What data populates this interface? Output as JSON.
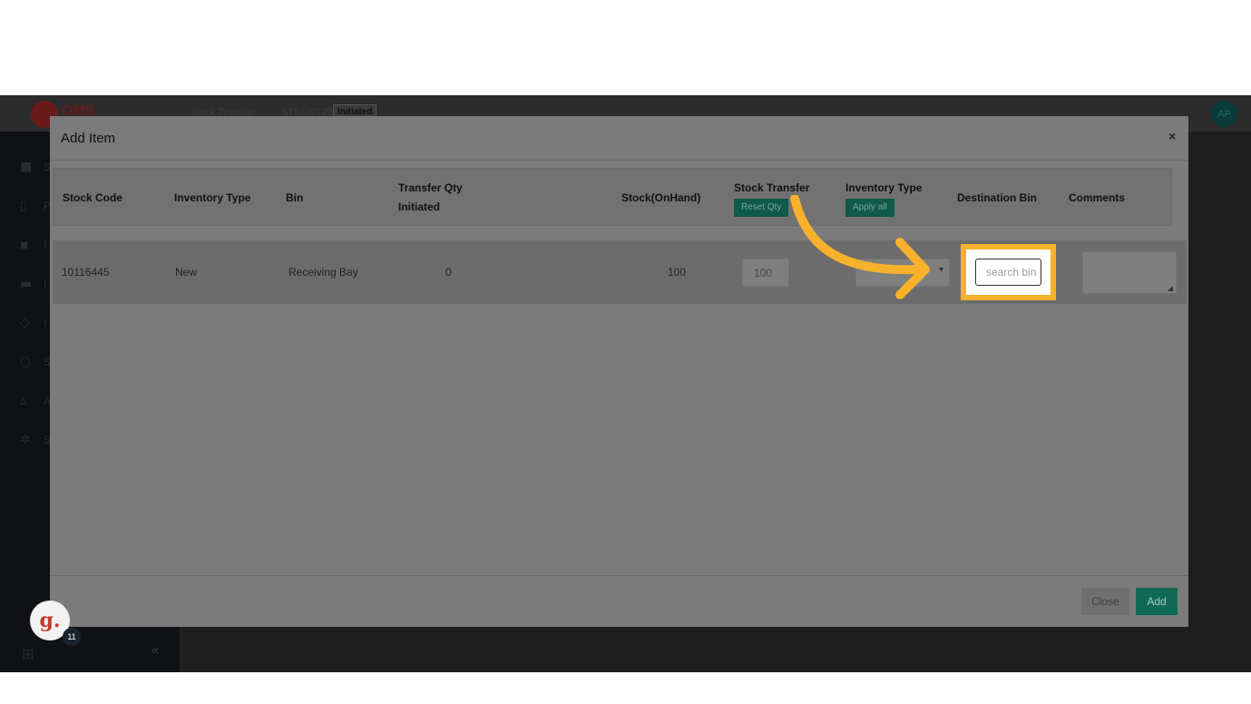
{
  "app": {
    "logo_text": "OMS",
    "breadcrumb_parent": "Stock Transfer",
    "breadcrumb_id": "ST5100125",
    "status_badge": "Initiated",
    "avatar_initials": "AP"
  },
  "sidebar": {
    "items": [
      {
        "icon": "truck-icon",
        "letter": "S"
      },
      {
        "icon": "document-icon",
        "letter": "P"
      },
      {
        "icon": "boxes-icon",
        "letter": "I"
      },
      {
        "icon": "warehouse-icon",
        "letter": "I"
      },
      {
        "icon": "cube-icon",
        "letter": "I"
      },
      {
        "icon": "users-icon",
        "letter": "S"
      },
      {
        "icon": "chart-icon",
        "letter": "A"
      },
      {
        "icon": "gear-icon",
        "letter": "S"
      }
    ]
  },
  "modal": {
    "title": "Add Item",
    "close_symbol": "×",
    "columns": {
      "stock_code": "Stock Code",
      "inventory_type": "Inventory Type",
      "bin": "Bin",
      "transfer_qty_line1": "Transfer Qty",
      "transfer_qty_line2": "Initiated",
      "stock_on_hand": "Stock(OnHand)",
      "stock_transfer": "Stock Transfer",
      "inventory_type_2": "Inventory Type",
      "destination_bin": "Destination Bin",
      "comments": "Comments"
    },
    "header_buttons": {
      "reset_qty": "Reset Qty",
      "apply_all": "Apply all"
    },
    "row": {
      "stock_code": "10116445",
      "inventory_type": "New",
      "bin": "Receiving Bay",
      "transfer_qty_initiated": "0",
      "stock_on_hand": "100",
      "stock_transfer_value": "100",
      "destination_bin_placeholder": "search bin"
    },
    "footer": {
      "close_label": "Close",
      "add_label": "Add"
    }
  },
  "overlay": {
    "guide_logo": "g.",
    "guide_count": "11",
    "highlight_color": "#f7b12b"
  }
}
